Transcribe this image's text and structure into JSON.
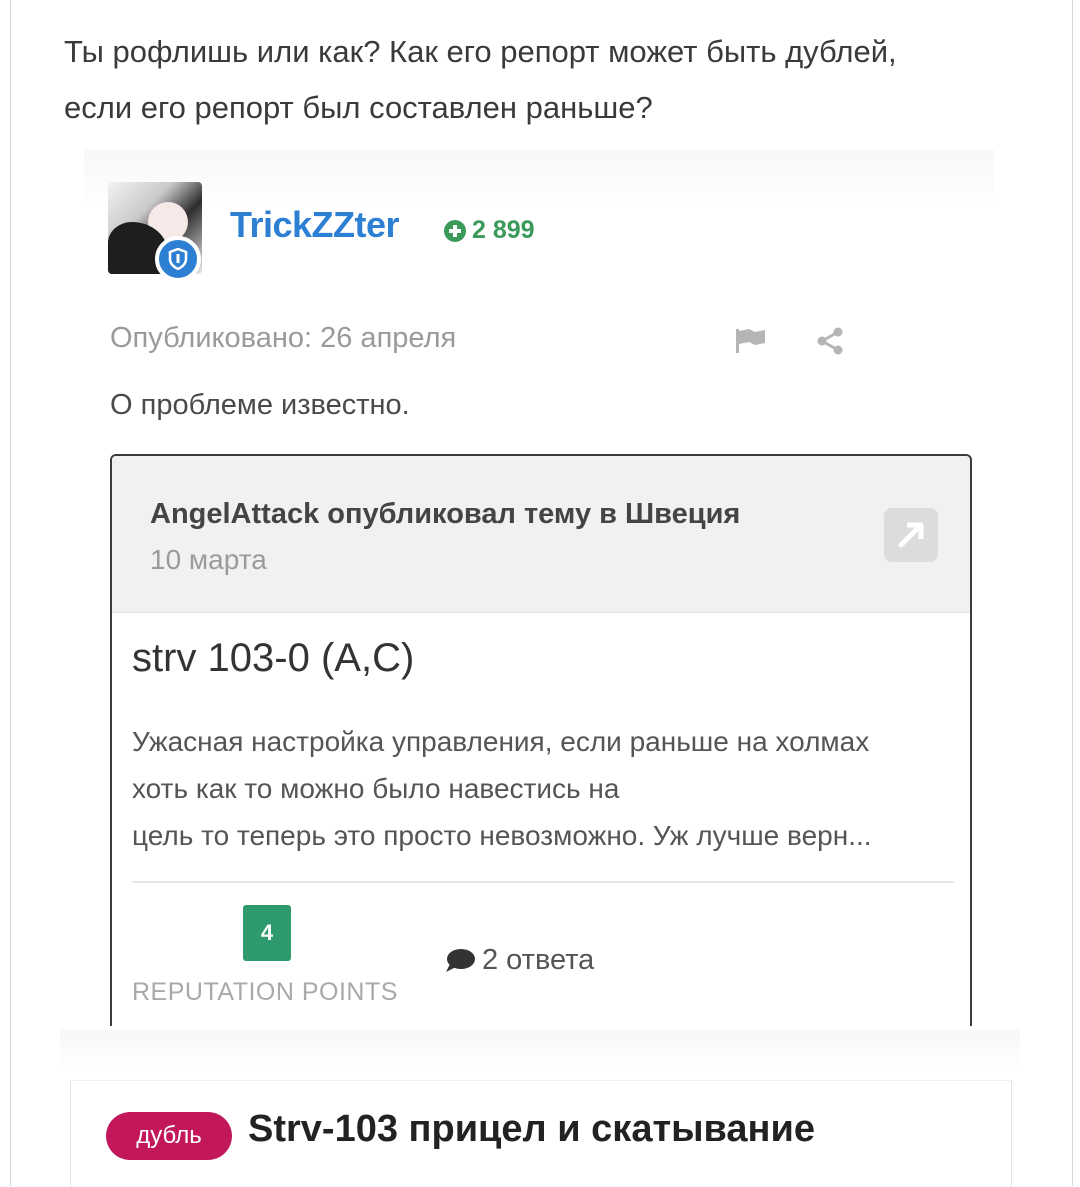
{
  "comment": {
    "lines": [
      "Ты рофлишь или как? Как его репорт может быть дублей,",
      "если его репорт был составлен раньше?"
    ]
  },
  "quote": {
    "username": "TrickZZter",
    "reputation": "2 899",
    "published": "Опубликовано: 26 апреля",
    "text": "О проблеме известно.",
    "embed": {
      "author_line": "AngelAttack опубликовал тему в Швеция",
      "date": "10 марта",
      "title": "strv 103-0 (A,C)",
      "body_lines": [
        "Ужасная настройка управления, если раньше на холмах",
        "хоть как то можно было навестись на",
        "цель то теперь это просто невозможно.  Уж лучше верн..."
      ],
      "reputation_points": "4",
      "reputation_label": "REPUTATION POINTS",
      "replies": "2 ответа"
    }
  },
  "topic": {
    "badge": "дубль",
    "title": "Strv-103 прицел и скатывание"
  },
  "colors": {
    "username": "#2d7fd3",
    "reputation": "#3a9a5a",
    "badge": "#c2185b",
    "rep_points_badge": "#2f9a6e"
  }
}
